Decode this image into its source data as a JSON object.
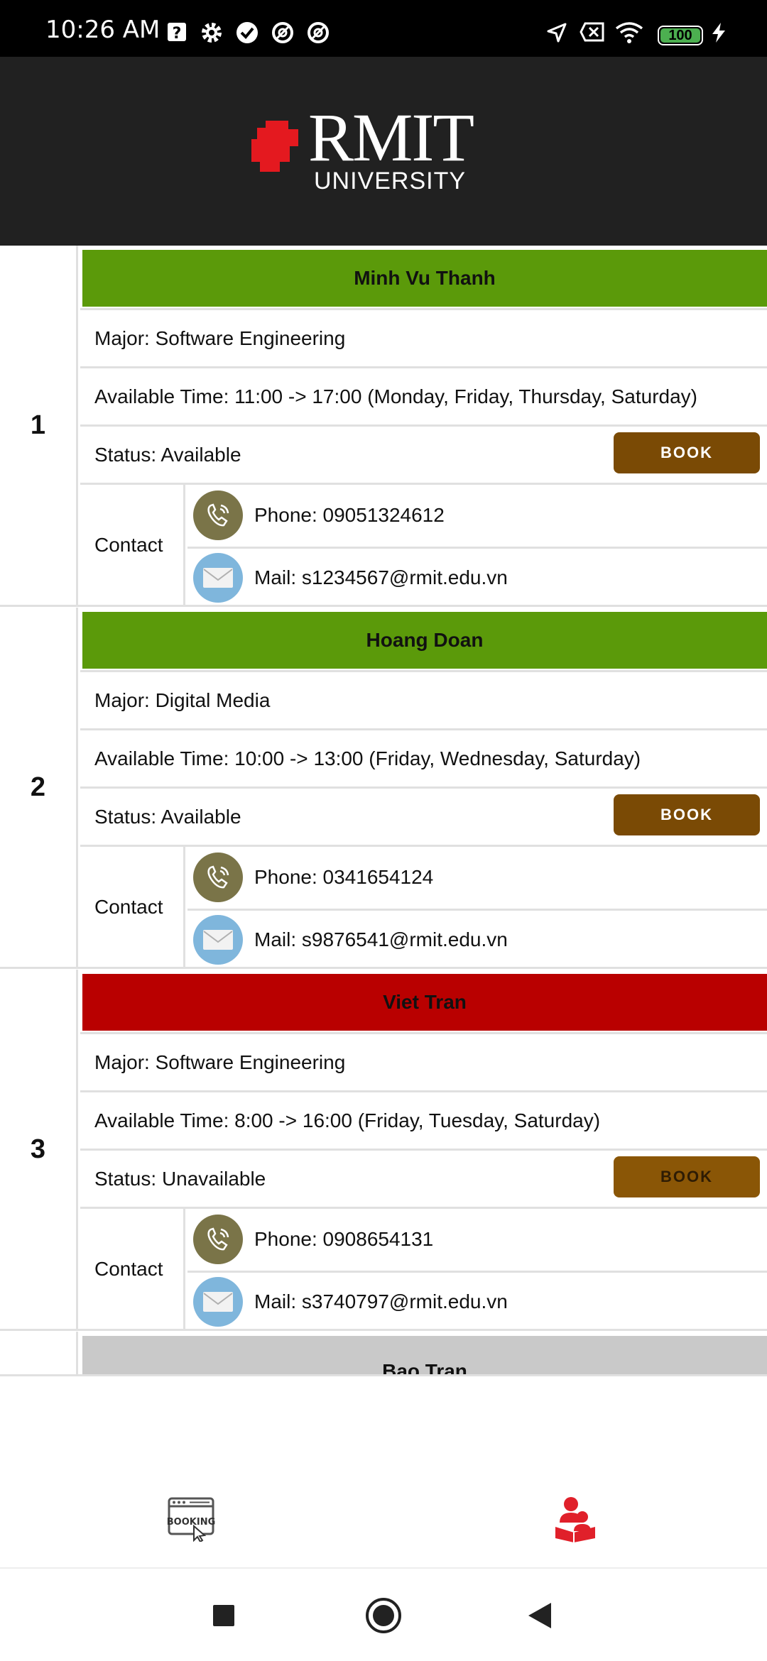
{
  "status_bar": {
    "time": "10:26 AM",
    "battery": "100",
    "icons": [
      "help-box-icon",
      "gear-icon",
      "check-circle-icon",
      "at-sign-icon",
      "at-sign-icon",
      "location-arrow-icon",
      "no-sim-icon",
      "wifi-icon",
      "battery-icon",
      "charging-bolt-icon"
    ]
  },
  "header": {
    "logo_main": "RMIT",
    "logo_sub": "UNIVERSITY"
  },
  "tutors": [
    {
      "index": "1",
      "name": "Minh Vu Thanh",
      "name_color": "#5b9a0a",
      "major": "Major: Software Engineering",
      "available_time": "Available Time: 11:00 -> 17:00 (Monday, Friday, Thursday, Saturday)",
      "status": "Status: Available",
      "book_label": "BOOK",
      "contact_label": "Contact",
      "phone": "Phone: 09051324612",
      "mail": "Mail: s1234567@rmit.edu.vn"
    },
    {
      "index": "2",
      "name": "Hoang Doan",
      "name_color": "#5b9a0a",
      "major": "Major: Digital Media",
      "available_time": "Available Time: 10:00 -> 13:00 (Friday, Wednesday, Saturday)",
      "status": "Status: Available",
      "book_label": "BOOK",
      "contact_label": "Contact",
      "phone": "Phone: 0341654124",
      "mail": "Mail: s9876541@rmit.edu.vn"
    },
    {
      "index": "3",
      "name": "Viet Tran",
      "name_color": "#b90000",
      "major": "Major: Software Engineering",
      "available_time": "Available Time: 8:00 -> 16:00 (Friday, Tuesday, Saturday)",
      "status": "Status: Unavailable",
      "book_label": "BOOK",
      "contact_label": "Contact",
      "phone": "Phone: 0908654131",
      "mail": "Mail: s3740797@rmit.edu.vn"
    },
    {
      "index": "",
      "name": "Bao Tran",
      "name_color": "#c9c9c9"
    }
  ],
  "bottom_nav": {
    "tabs": [
      {
        "icon": "booking-icon",
        "label": "BOOKING"
      },
      {
        "icon": "tutor-reading-icon",
        "active": true
      }
    ],
    "accent": "#e0202a"
  },
  "system_nav": [
    "recents-square-icon",
    "home-circle-icon",
    "back-triangle-icon"
  ]
}
